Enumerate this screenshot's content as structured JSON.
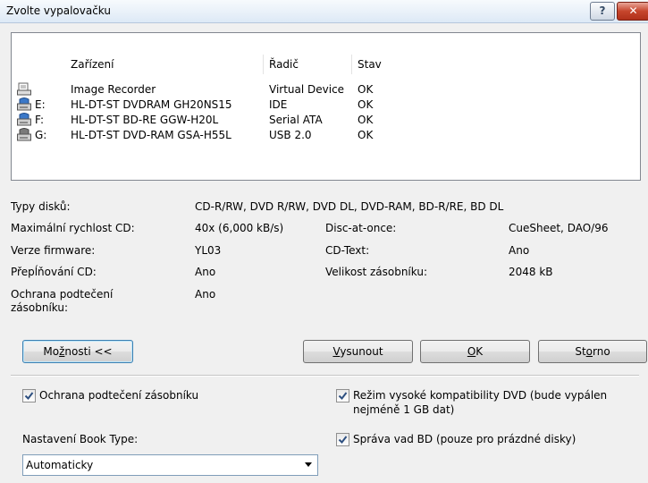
{
  "window": {
    "title": "Zvolte vypalovačku",
    "help_label": "?",
    "close_label": "✕"
  },
  "table": {
    "columns": [
      "Zařízení",
      "Řadič",
      "Stav"
    ],
    "rows": [
      {
        "icon": "image-recorder-icon",
        "letter": "",
        "device": "Image Recorder",
        "controller": "Virtual Device",
        "status": "OK"
      },
      {
        "icon": "disc-drive-icon",
        "letter": "E:",
        "device": "HL-DT-ST DVDRAM GH20NS15",
        "controller": "IDE",
        "status": "OK"
      },
      {
        "icon": "disc-drive-icon",
        "letter": "F:",
        "device": "HL-DT-ST BD-RE  GGW-H20L",
        "controller": "Serial ATA",
        "status": "OK"
      },
      {
        "icon": "disc-drive-icon",
        "letter": "G:",
        "device": "HL-DT-ST DVD-RAM GSA-H55L",
        "controller": "USB 2.0",
        "status": "OK"
      }
    ]
  },
  "info": {
    "disc_types_label": "Typy disků:",
    "disc_types_value": "CD-R/RW, DVD R/RW, DVD DL, DVD-RAM, BD-R/RE, BD DL",
    "max_speed_label": "Maximální rychlost CD:",
    "max_speed_value": "40x (6,000 kB/s)",
    "firmware_label": "Verze firmware:",
    "firmware_value": "YL03",
    "overburn_label": "Přepĺňování CD:",
    "overburn_value": "Ano",
    "underrun_label_1": "Ochrana podtečení",
    "underrun_label_2": "zásobníku:",
    "underrun_value": "Ano",
    "dao_label": "Disc-at-once:",
    "dao_value": "CueSheet, DAO/96",
    "cdtext_label": "CD-Text:",
    "cdtext_value": "Ano",
    "buffer_label": "Velikost zásobníku:",
    "buffer_value": "2048 kB"
  },
  "buttons": {
    "options_pre": "Mo",
    "options_u": "ž",
    "options_post": "nosti <<",
    "eject_u": "V",
    "eject_post": "ysunout",
    "ok_u": "O",
    "ok_post": "K",
    "cancel_pre": "St",
    "cancel_u": "o",
    "cancel_post": "rno"
  },
  "options": {
    "underrun_protection": "Ochrana podtečení zásobníku",
    "underrun_checked": true,
    "dvd_compat_line1": "Režim vysoké kompatibility DVD (bude vypálen",
    "dvd_compat_line2": "nejméně 1 GB dat)",
    "dvd_compat_checked": true,
    "bd_defect": "Správa vad BD (pouze pro prázdné disky)",
    "bd_defect_checked": true,
    "book_type_label": "Nastavení Book Type:",
    "book_type_value": "Automaticky"
  },
  "colors": {
    "accent": "#3c7fb1",
    "window_bg": "#f0f0f0"
  }
}
